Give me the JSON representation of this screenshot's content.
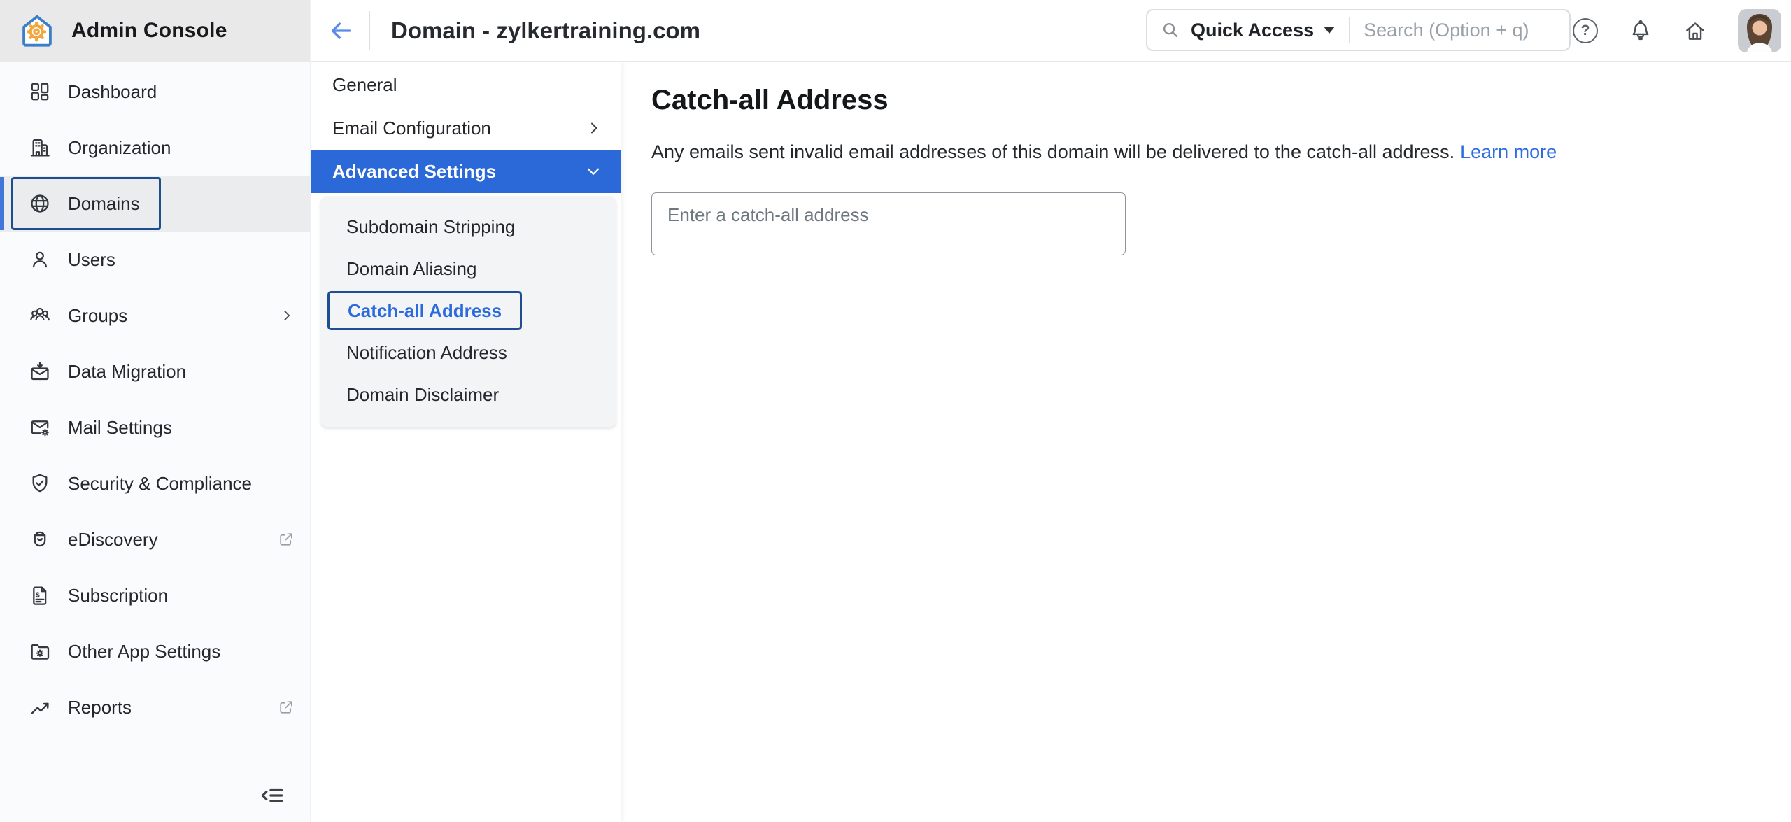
{
  "app": {
    "title": "Admin Console",
    "logo_icon": "house-gear"
  },
  "header": {
    "back_icon": "arrow-left",
    "page_title": "Domain - zylkertraining.com",
    "quick_access_label": "Quick Access",
    "search_placeholder": "Search (Option + q)",
    "help_glyph": "?",
    "icons": [
      "help-icon",
      "bell-icon",
      "home-icon",
      "avatar"
    ]
  },
  "sidebar": {
    "items": [
      {
        "label": "Dashboard",
        "icon": "dashboard-grid"
      },
      {
        "label": "Organization",
        "icon": "building"
      },
      {
        "label": "Domains",
        "icon": "globe",
        "selected": true
      },
      {
        "label": "Users",
        "icon": "person"
      },
      {
        "label": "Groups",
        "icon": "people-group",
        "trailing": "chevron-right"
      },
      {
        "label": "Data Migration",
        "icon": "mail-download"
      },
      {
        "label": "Mail Settings",
        "icon": "mail-gear"
      },
      {
        "label": "Security & Compliance",
        "icon": "shield-check"
      },
      {
        "label": "eDiscovery",
        "icon": "archive-jar",
        "trailing": "external-link"
      },
      {
        "label": "Subscription",
        "icon": "invoice-dollar"
      },
      {
        "label": "Other App Settings",
        "icon": "folder-gear"
      },
      {
        "label": "Reports",
        "icon": "trending-up",
        "trailing": "external-link"
      }
    ],
    "collapse_icon": "collapse-menu"
  },
  "subnav": {
    "items": [
      {
        "label": "General"
      },
      {
        "label": "Email Configuration",
        "trailing": "chevron-right"
      },
      {
        "label": "Advanced Settings",
        "selected": true,
        "trailing": "chevron-down"
      }
    ],
    "advanced_children": [
      {
        "label": "Subdomain Stripping"
      },
      {
        "label": "Domain Aliasing"
      },
      {
        "label": "Catch-all Address",
        "selected": true
      },
      {
        "label": "Notification Address"
      },
      {
        "label": "Domain Disclaimer"
      }
    ]
  },
  "main": {
    "title": "Catch-all Address",
    "description": "Any emails sent invalid email addresses of this domain will be delivered to the catch-all address.",
    "learn_more_label": "Learn more",
    "input_placeholder": "Enter a catch-all address",
    "input_value": ""
  },
  "icons": {
    "subscription_dollar": "$"
  },
  "colors": {
    "accent_blue": "#2b69d8",
    "selection_border_navy": "#1d4e91",
    "selected_link_blue": "#2b6bdb",
    "link_blue": "#2e6ce0",
    "sidebar_bg": "#fafbfc",
    "logo_area_bg": "#e9e9e9",
    "subgroup_bg": "#f3f4f6",
    "logo_orange": "#f2a73d",
    "logo_house_blue": "#3b7ec9"
  }
}
